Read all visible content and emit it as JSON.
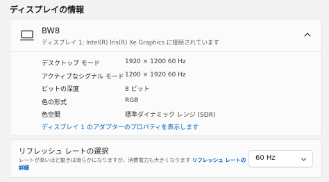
{
  "section_title": "ディスプレイの情報",
  "display": {
    "name": "BW8",
    "description": "ディスプレイ 1: Intel(R) Iris(R) Xe Graphics に接続されています",
    "icon": "monitor-icon",
    "rows": [
      {
        "label": "デスクトップ モード",
        "value": "1920 × 1200 60 Hz"
      },
      {
        "label": "アクティブなシグナル モード",
        "value": "1200 × 1920 60 Hz"
      },
      {
        "label": "ビットの深度",
        "value": "8 ビット"
      },
      {
        "label": "色の形式",
        "value": "RGB"
      },
      {
        "label": "色空間",
        "value": "標準ダイナミック レンジ (SDR)"
      }
    ],
    "adapter_link": "ディスプレイ 1 のアダプターのプロパティを表示します"
  },
  "refresh": {
    "title": "リフレッシュ レートの選択",
    "description_prefix": "レートが高いほど動きは滑らかになりますが、消費電力も大きくなります",
    "link": "リフレッシュ レートの詳細",
    "selected": "60 Hz"
  },
  "colors": {
    "accent": "#005fb8",
    "background": "#f3f3f3",
    "card": "#fbfbfb"
  }
}
